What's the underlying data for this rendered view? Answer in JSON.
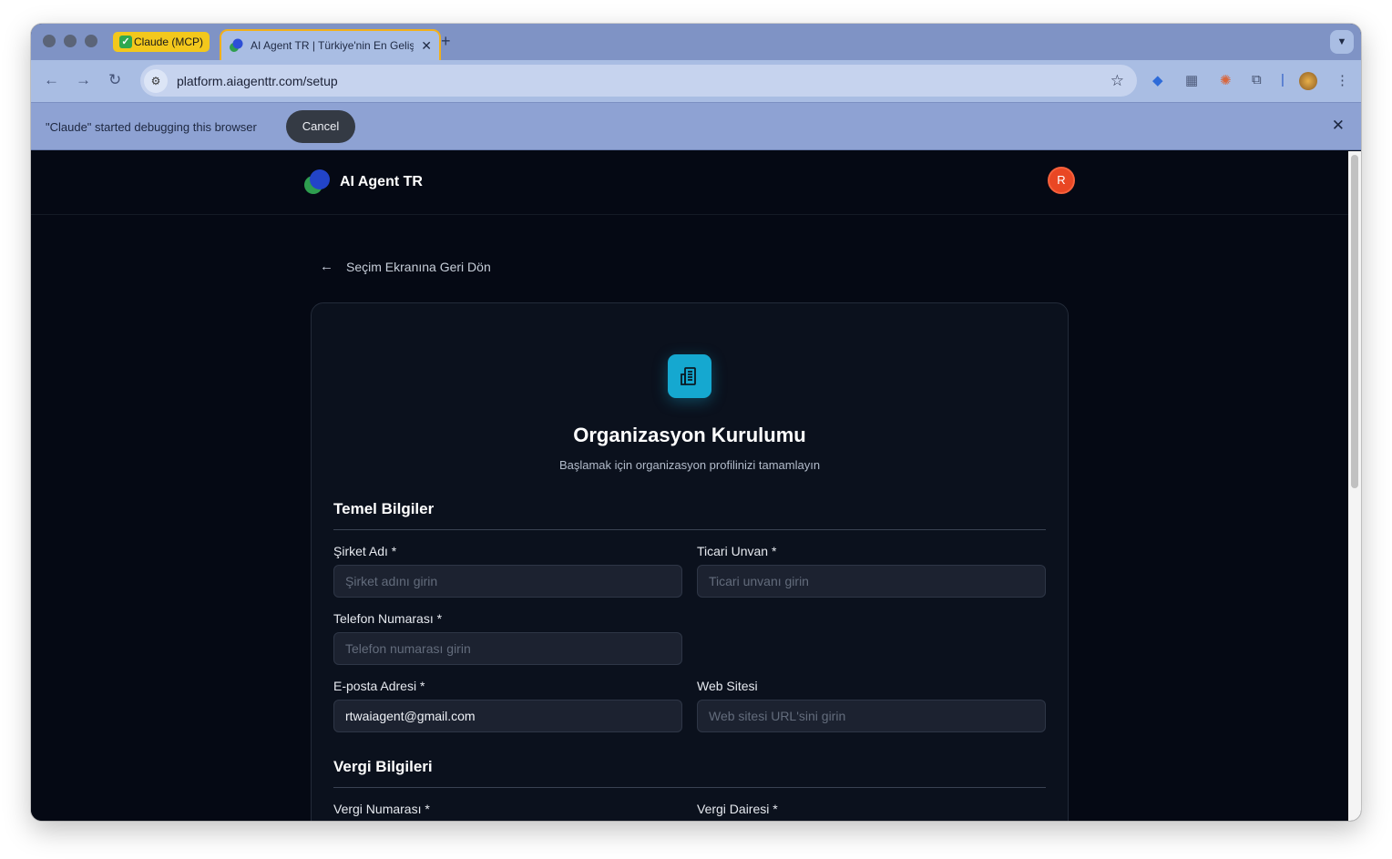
{
  "browser": {
    "tabs": [
      {
        "label": "Claude (MCP)",
        "check": "✓"
      },
      {
        "label": "AI Agent TR | Türkiye'nin En Gelişmiş"
      }
    ],
    "url": "platform.aiagenttr.com/setup",
    "infobar": {
      "message": "\"Claude\" started debugging this browser",
      "cancel_label": "Cancel"
    }
  },
  "site": {
    "brand": "AI Agent TR",
    "user_initial": "R"
  },
  "back_link": "Seçim Ekranına Geri Dön",
  "card": {
    "title": "Organizasyon Kurulumu",
    "subtitle": "Başlamak için organizasyon profilinizi tamamlayın",
    "sections": {
      "basic": "Temel Bilgiler",
      "tax": "Vergi Bilgileri"
    },
    "fields": {
      "company_name": {
        "label": "Şirket Adı *",
        "placeholder": "Şirket adını girin",
        "value": ""
      },
      "trade_name": {
        "label": "Ticari Unvan *",
        "placeholder": "Ticari unvanı girin",
        "value": ""
      },
      "phone": {
        "label": "Telefon Numarası *",
        "placeholder": "Telefon numarası girin",
        "value": ""
      },
      "email": {
        "label": "E-posta Adresi *",
        "placeholder": "",
        "value": "rtwaiagent@gmail.com"
      },
      "website": {
        "label": "Web Sitesi",
        "placeholder": "Web sitesi URL'sini girin",
        "value": ""
      },
      "tax_number": {
        "label": "Vergi Numarası *"
      },
      "tax_office": {
        "label": "Vergi Dairesi *"
      }
    }
  },
  "colors": {
    "page_bg": "#050914",
    "card_bg": "#0b111d",
    "accent": "#15a8d0",
    "avatar": "#e94724",
    "mcp_tab": "#f3c81c"
  }
}
